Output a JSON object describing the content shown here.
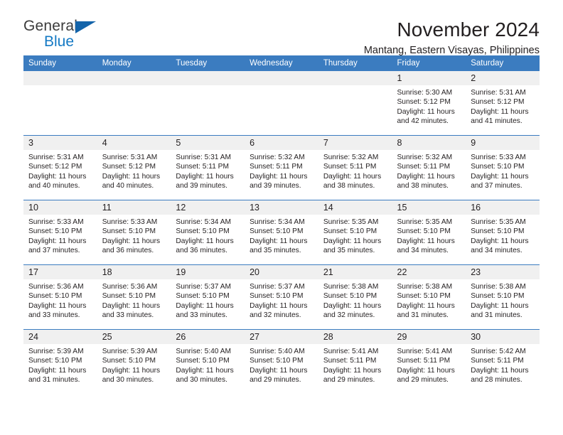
{
  "logo": {
    "word1": "General",
    "word2": "Blue",
    "triangle_color": "#1464aa",
    "blue_color": "#1479c4"
  },
  "header": {
    "title": "November 2024",
    "location": "Mantang, Eastern Visayas, Philippines"
  },
  "theme": {
    "header_bg": "#3b7cc0",
    "daynum_bg": "#f0f0f0",
    "text": "#231f20"
  },
  "weekdays": [
    "Sunday",
    "Monday",
    "Tuesday",
    "Wednesday",
    "Thursday",
    "Friday",
    "Saturday"
  ],
  "labels": {
    "sunrise_prefix": "Sunrise:",
    "sunset_prefix": "Sunset:",
    "daylight_prefix": "Daylight:"
  },
  "weeks": [
    [
      {
        "day": "",
        "empty": true
      },
      {
        "day": "",
        "empty": true
      },
      {
        "day": "",
        "empty": true
      },
      {
        "day": "",
        "empty": true
      },
      {
        "day": "",
        "empty": true
      },
      {
        "day": "1",
        "sunrise": "Sunrise: 5:30 AM",
        "sunset": "Sunset: 5:12 PM",
        "daylight_l1": "Daylight: 11 hours",
        "daylight_l2": "and 42 minutes."
      },
      {
        "day": "2",
        "sunrise": "Sunrise: 5:31 AM",
        "sunset": "Sunset: 5:12 PM",
        "daylight_l1": "Daylight: 11 hours",
        "daylight_l2": "and 41 minutes."
      }
    ],
    [
      {
        "day": "3",
        "sunrise": "Sunrise: 5:31 AM",
        "sunset": "Sunset: 5:12 PM",
        "daylight_l1": "Daylight: 11 hours",
        "daylight_l2": "and 40 minutes."
      },
      {
        "day": "4",
        "sunrise": "Sunrise: 5:31 AM",
        "sunset": "Sunset: 5:12 PM",
        "daylight_l1": "Daylight: 11 hours",
        "daylight_l2": "and 40 minutes."
      },
      {
        "day": "5",
        "sunrise": "Sunrise: 5:31 AM",
        "sunset": "Sunset: 5:11 PM",
        "daylight_l1": "Daylight: 11 hours",
        "daylight_l2": "and 39 minutes."
      },
      {
        "day": "6",
        "sunrise": "Sunrise: 5:32 AM",
        "sunset": "Sunset: 5:11 PM",
        "daylight_l1": "Daylight: 11 hours",
        "daylight_l2": "and 39 minutes."
      },
      {
        "day": "7",
        "sunrise": "Sunrise: 5:32 AM",
        "sunset": "Sunset: 5:11 PM",
        "daylight_l1": "Daylight: 11 hours",
        "daylight_l2": "and 38 minutes."
      },
      {
        "day": "8",
        "sunrise": "Sunrise: 5:32 AM",
        "sunset": "Sunset: 5:11 PM",
        "daylight_l1": "Daylight: 11 hours",
        "daylight_l2": "and 38 minutes."
      },
      {
        "day": "9",
        "sunrise": "Sunrise: 5:33 AM",
        "sunset": "Sunset: 5:10 PM",
        "daylight_l1": "Daylight: 11 hours",
        "daylight_l2": "and 37 minutes."
      }
    ],
    [
      {
        "day": "10",
        "sunrise": "Sunrise: 5:33 AM",
        "sunset": "Sunset: 5:10 PM",
        "daylight_l1": "Daylight: 11 hours",
        "daylight_l2": "and 37 minutes."
      },
      {
        "day": "11",
        "sunrise": "Sunrise: 5:33 AM",
        "sunset": "Sunset: 5:10 PM",
        "daylight_l1": "Daylight: 11 hours",
        "daylight_l2": "and 36 minutes."
      },
      {
        "day": "12",
        "sunrise": "Sunrise: 5:34 AM",
        "sunset": "Sunset: 5:10 PM",
        "daylight_l1": "Daylight: 11 hours",
        "daylight_l2": "and 36 minutes."
      },
      {
        "day": "13",
        "sunrise": "Sunrise: 5:34 AM",
        "sunset": "Sunset: 5:10 PM",
        "daylight_l1": "Daylight: 11 hours",
        "daylight_l2": "and 35 minutes."
      },
      {
        "day": "14",
        "sunrise": "Sunrise: 5:35 AM",
        "sunset": "Sunset: 5:10 PM",
        "daylight_l1": "Daylight: 11 hours",
        "daylight_l2": "and 35 minutes."
      },
      {
        "day": "15",
        "sunrise": "Sunrise: 5:35 AM",
        "sunset": "Sunset: 5:10 PM",
        "daylight_l1": "Daylight: 11 hours",
        "daylight_l2": "and 34 minutes."
      },
      {
        "day": "16",
        "sunrise": "Sunrise: 5:35 AM",
        "sunset": "Sunset: 5:10 PM",
        "daylight_l1": "Daylight: 11 hours",
        "daylight_l2": "and 34 minutes."
      }
    ],
    [
      {
        "day": "17",
        "sunrise": "Sunrise: 5:36 AM",
        "sunset": "Sunset: 5:10 PM",
        "daylight_l1": "Daylight: 11 hours",
        "daylight_l2": "and 33 minutes."
      },
      {
        "day": "18",
        "sunrise": "Sunrise: 5:36 AM",
        "sunset": "Sunset: 5:10 PM",
        "daylight_l1": "Daylight: 11 hours",
        "daylight_l2": "and 33 minutes."
      },
      {
        "day": "19",
        "sunrise": "Sunrise: 5:37 AM",
        "sunset": "Sunset: 5:10 PM",
        "daylight_l1": "Daylight: 11 hours",
        "daylight_l2": "and 33 minutes."
      },
      {
        "day": "20",
        "sunrise": "Sunrise: 5:37 AM",
        "sunset": "Sunset: 5:10 PM",
        "daylight_l1": "Daylight: 11 hours",
        "daylight_l2": "and 32 minutes."
      },
      {
        "day": "21",
        "sunrise": "Sunrise: 5:38 AM",
        "sunset": "Sunset: 5:10 PM",
        "daylight_l1": "Daylight: 11 hours",
        "daylight_l2": "and 32 minutes."
      },
      {
        "day": "22",
        "sunrise": "Sunrise: 5:38 AM",
        "sunset": "Sunset: 5:10 PM",
        "daylight_l1": "Daylight: 11 hours",
        "daylight_l2": "and 31 minutes."
      },
      {
        "day": "23",
        "sunrise": "Sunrise: 5:38 AM",
        "sunset": "Sunset: 5:10 PM",
        "daylight_l1": "Daylight: 11 hours",
        "daylight_l2": "and 31 minutes."
      }
    ],
    [
      {
        "day": "24",
        "sunrise": "Sunrise: 5:39 AM",
        "sunset": "Sunset: 5:10 PM",
        "daylight_l1": "Daylight: 11 hours",
        "daylight_l2": "and 31 minutes."
      },
      {
        "day": "25",
        "sunrise": "Sunrise: 5:39 AM",
        "sunset": "Sunset: 5:10 PM",
        "daylight_l1": "Daylight: 11 hours",
        "daylight_l2": "and 30 minutes."
      },
      {
        "day": "26",
        "sunrise": "Sunrise: 5:40 AM",
        "sunset": "Sunset: 5:10 PM",
        "daylight_l1": "Daylight: 11 hours",
        "daylight_l2": "and 30 minutes."
      },
      {
        "day": "27",
        "sunrise": "Sunrise: 5:40 AM",
        "sunset": "Sunset: 5:10 PM",
        "daylight_l1": "Daylight: 11 hours",
        "daylight_l2": "and 29 minutes."
      },
      {
        "day": "28",
        "sunrise": "Sunrise: 5:41 AM",
        "sunset": "Sunset: 5:11 PM",
        "daylight_l1": "Daylight: 11 hours",
        "daylight_l2": "and 29 minutes."
      },
      {
        "day": "29",
        "sunrise": "Sunrise: 5:41 AM",
        "sunset": "Sunset: 5:11 PM",
        "daylight_l1": "Daylight: 11 hours",
        "daylight_l2": "and 29 minutes."
      },
      {
        "day": "30",
        "sunrise": "Sunrise: 5:42 AM",
        "sunset": "Sunset: 5:11 PM",
        "daylight_l1": "Daylight: 11 hours",
        "daylight_l2": "and 28 minutes."
      }
    ]
  ]
}
